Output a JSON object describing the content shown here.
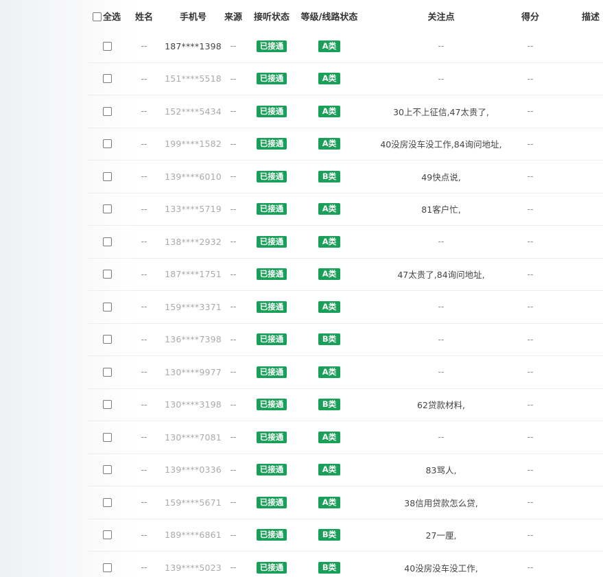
{
  "header": {
    "select_all": "全选",
    "name": "姓名",
    "phone": "手机号",
    "source": "来源",
    "answer_status": "接听状态",
    "level_line_status": "等级/线路状态",
    "focus": "关注点",
    "score": "得分",
    "description": "描述"
  },
  "colors": {
    "tag_green": "#18a058"
  },
  "rows": [
    {
      "name": "--",
      "phone": "187****1398",
      "source": "--",
      "answer": "已接通",
      "level": "A类",
      "focus": "--",
      "score": "--"
    },
    {
      "name": "--",
      "phone": "151****5518",
      "source": "--",
      "answer": "已接通",
      "level": "A类",
      "focus": "--",
      "score": "--"
    },
    {
      "name": "--",
      "phone": "152****5434",
      "source": "--",
      "answer": "已接通",
      "level": "A类",
      "focus": "30上不上征信,47太贵了,",
      "score": "--"
    },
    {
      "name": "--",
      "phone": "199****1582",
      "source": "--",
      "answer": "已接通",
      "level": "A类",
      "focus": "40没房没车没工作,84询问地址,",
      "score": "--"
    },
    {
      "name": "--",
      "phone": "139****6010",
      "source": "--",
      "answer": "已接通",
      "level": "B类",
      "focus": "49快点说,",
      "score": "--"
    },
    {
      "name": "--",
      "phone": "133****5719",
      "source": "--",
      "answer": "已接通",
      "level": "A类",
      "focus": "81客户忙,",
      "score": "--"
    },
    {
      "name": "--",
      "phone": "138****2932",
      "source": "--",
      "answer": "已接通",
      "level": "A类",
      "focus": "--",
      "score": "--"
    },
    {
      "name": "--",
      "phone": "187****1751",
      "source": "--",
      "answer": "已接通",
      "level": "A类",
      "focus": "47太贵了,84询问地址,",
      "score": "--"
    },
    {
      "name": "--",
      "phone": "159****3371",
      "source": "--",
      "answer": "已接通",
      "level": "A类",
      "focus": "--",
      "score": "--"
    },
    {
      "name": "--",
      "phone": "136****7398",
      "source": "--",
      "answer": "已接通",
      "level": "B类",
      "focus": "--",
      "score": "--"
    },
    {
      "name": "--",
      "phone": "130****9977",
      "source": "--",
      "answer": "已接通",
      "level": "A类",
      "focus": "--",
      "score": "--"
    },
    {
      "name": "--",
      "phone": "130****3198",
      "source": "--",
      "answer": "已接通",
      "level": "B类",
      "focus": "62贷款材料,",
      "score": "--"
    },
    {
      "name": "--",
      "phone": "130****7081",
      "source": "--",
      "answer": "已接通",
      "level": "A类",
      "focus": "--",
      "score": "--"
    },
    {
      "name": "--",
      "phone": "139****0336",
      "source": "--",
      "answer": "已接通",
      "level": "A类",
      "focus": "83骂人,",
      "score": "--"
    },
    {
      "name": "--",
      "phone": "159****5671",
      "source": "--",
      "answer": "已接通",
      "level": "A类",
      "focus": "38信用贷款怎么贷,",
      "score": "--"
    },
    {
      "name": "--",
      "phone": "189****6861",
      "source": "--",
      "answer": "已接通",
      "level": "B类",
      "focus": "27一厘,",
      "score": "--"
    },
    {
      "name": "--",
      "phone": "139****5023",
      "source": "--",
      "answer": "已接通",
      "level": "B类",
      "focus": "40没房没车没工作,",
      "score": "--"
    }
  ]
}
